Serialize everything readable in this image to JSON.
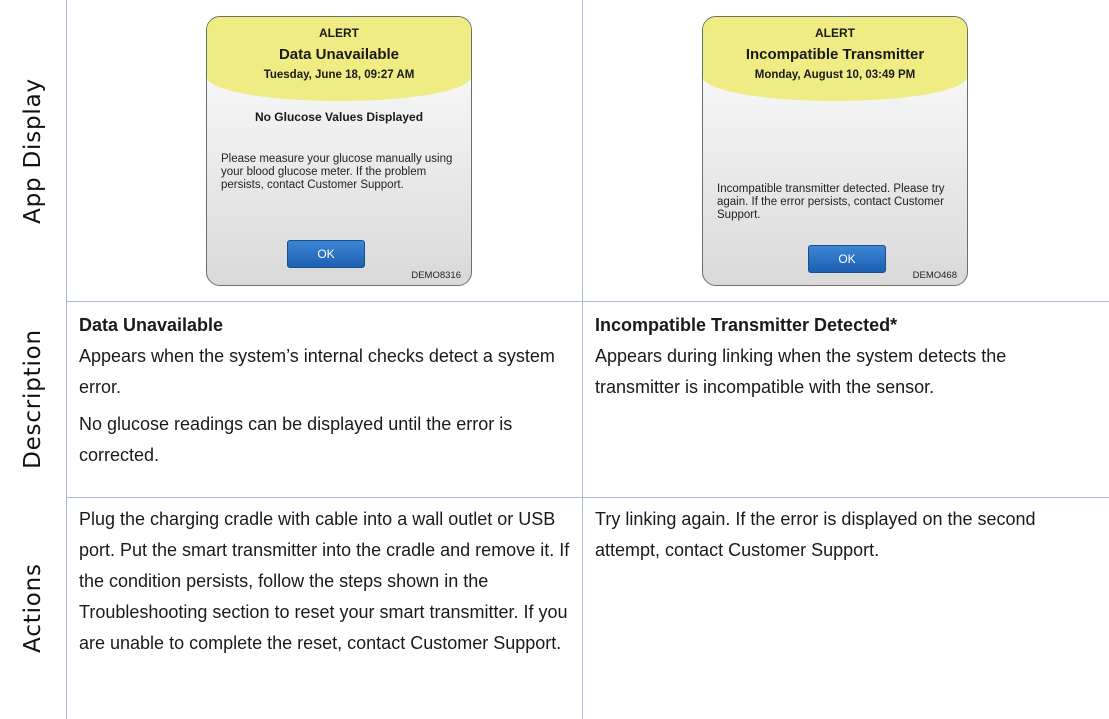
{
  "rows": {
    "app_display": "App Display",
    "description": "Description",
    "actions": "Actions"
  },
  "left": {
    "app": {
      "alert": "ALERT",
      "title": "Data Unavailable",
      "date": "Tuesday, June 18, 09:27 AM",
      "subheading": "No Glucose Values Displayed",
      "body": "Please measure your glucose manually using your blood glucose meter. If the problem persists, contact Customer Support.",
      "ok": "OK",
      "code": "DEMO8316"
    },
    "description": {
      "title": "Data Unavailable",
      "p1": "Appears when the system’s internal checks detect a system error.",
      "p2": "No glucose readings can be displayed until the error is corrected."
    },
    "actions": "Plug the charging cradle with cable into a wall outlet or USB port. Put the smart transmitter into the cradle and remove it. If the condition persists, follow the steps shown in the Troubleshooting section to reset your smart transmitter. If you are unable to complete the reset, contact Customer Support."
  },
  "right": {
    "app": {
      "alert": "ALERT",
      "title": "Incompatible Transmitter",
      "date": "Monday, August 10, 03:49 PM",
      "body": "Incompatible transmitter detected. Please try again. If the error persists, contact Customer Support.",
      "ok": "OK",
      "code": "DEMO468"
    },
    "description": {
      "title": "Incompatible Transmitter Detected*",
      "p1": "Appears during linking when the system detects the transmitter is incompatible with the sensor."
    },
    "actions": "Try linking again. If the error is displayed on the second attempt, contact Customer Support."
  }
}
